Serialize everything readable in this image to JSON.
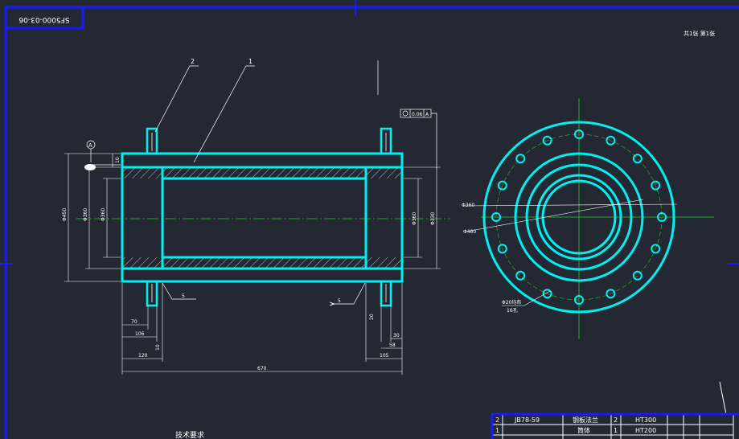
{
  "drawing": {
    "code": "SF5000-03-06",
    "top_right_note": "共1张 第1张",
    "tech_req_label": "技术要求",
    "balloons": [
      "1",
      "2"
    ],
    "datum_letter": "A",
    "tolerance_frame": {
      "value": "0.06",
      "datum": "A"
    },
    "section_marks": [
      "5",
      "5"
    ],
    "front_dims": {
      "left_outer_dia": "Φ450",
      "left_inner_dia": "Φ360",
      "right_inner_dia": "Φ360",
      "right_outer_dia": "Φ330",
      "small_label": "10",
      "d70": "70",
      "d106": "106",
      "d120": "120",
      "d_overall": "670",
      "d30": "30",
      "d58": "58",
      "d105": "105",
      "r_small": "10",
      "small_right": "20"
    },
    "side_dims": {
      "d1": "Φ360",
      "d2": "Φ460",
      "hole": "Φ20均布",
      "hole_count": "16孔"
    },
    "title_block": [
      {
        "idx": "2",
        "std": "JB78-59",
        "name": "钢板法兰",
        "qty": "2",
        "material": "HT300"
      },
      {
        "idx": "1",
        "std": "",
        "name": "筒体",
        "qty": "1",
        "material": "HT200"
      }
    ]
  }
}
